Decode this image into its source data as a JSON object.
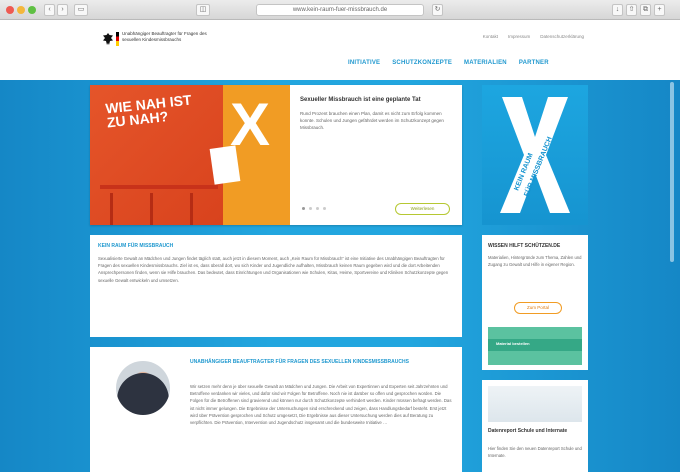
{
  "browser": {
    "url": "www.kein-raum-fuer-missbrauch.de"
  },
  "header": {
    "logo_text": "Unabhängiger Beauftragter für Fragen des sexuellen Kindesmissbrauchs",
    "util_nav": [
      "Kontakt",
      "Impressum",
      "Datenschutzerklärung"
    ],
    "main_nav": [
      "INITIATIVE",
      "SCHUTZKONZEPTE",
      "MATERIALIEN",
      "PARTNER"
    ]
  },
  "hero": {
    "image_title_line1": "WIE NAH IST",
    "image_title_line2": "ZU NAH?",
    "image_mark": "X",
    "headline": "Sexueller Missbrauch ist eine geplante Tat",
    "text": "Rund Prozent brauchen einen Plan, damit es nicht zum Erfolg kommen konnte. Schulen und Jungen gefährdet werden im Schutzkonzept gegen Missbrauch.",
    "button": "Weiterlesen"
  },
  "banner": {
    "line1": "KEIN RAUM",
    "line2": "FÜR MISSBRAUCH"
  },
  "card1": {
    "title": "KEIN RAUM FÜR MISSBRAUCH",
    "text": "Sexualisierte Gewalt an Mädchen und Jungen findet täglich statt, auch jetzt in diesem Moment, auch „Kein Raum für Missbrauch“ ist eine Initiative des Unabhängigen Beauftragten für Fragen des sexuellen Kindesmissbrauchs. Ziel ist es, dass überall dort, wo sich Kinder und Jugendliche aufhalten, Missbrauch keinen Raum gegeben wird und die dort Arbeitenden Ansprechpersonen finden, wenn sie Hilfe brauchen. Das bedeutet, dass Einrichtungen und Organisationen wie Schulen, Kitas, Heime, Sportvereine und Kliniken Schutzkonzepte gegen sexuelle Gewalt entwickeln und umsetzen."
  },
  "side1": {
    "title": "WISSEN HILFT SCHÜTZEN.DE",
    "text": "Materialien, Hintergründe zum Thema, Zahlen und Zugang zu Gewalt und Hilfe in eigener Region.",
    "button": "Zum Portal",
    "shot_label": "Material bestellen"
  },
  "card2": {
    "title": "UNABHÄNGIGER BEAUFTRAGTER FÜR FRAGEN DES SEXUELLEN KINDESMISSBRAUCHS",
    "text": "Wir setzen mehr denn je über sexuelle Gewalt an Mädchen und Jungen. Die Arbeit von Expertinnen und Experten seit Jahrzehnten und Betroffene verdanken wir vieles, und dafür sind wir Folgen für Betroffene. Noch nie ist darüber so offen und gesprochen worden. Die Folgen für die Betroffenen sind gravierend und können nur durch Schutzkonzepte verhindert werden. Kinder müssen befragt werden. Das ist nicht immer gelungen. Die Ergebnisse der Untersuchungen sind erschreckend und zeigen, dass Handlungsbedarf besteht. Erst jetzt wird über Prävention gesprochen und Schutz umgesetzt, Die Ergebnisse aus dieser Untersuchung werden dies auf Beratung zu verpflichten. Die Prävention, Intervention und Jugendschutz insgesamt und die bundesweite Initiative …"
  },
  "side2": {
    "title": "Datenreport Schule und Internate",
    "text": "Hier finden Sie den neuen Datenreport Schule und Internate."
  }
}
